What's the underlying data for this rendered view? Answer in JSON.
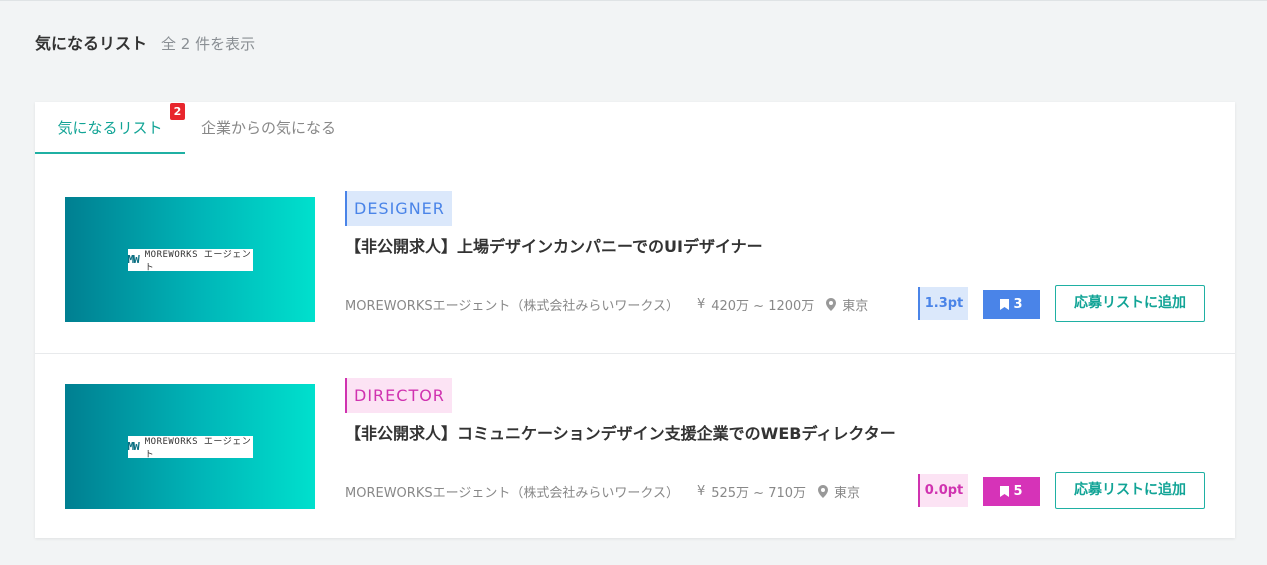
{
  "header": {
    "title": "気になるリスト",
    "count_text": "全 2 件を表示"
  },
  "tabs": [
    {
      "label": "気になるリスト",
      "badge": "2",
      "active": true
    },
    {
      "label": "企業からの気になる",
      "active": false
    }
  ],
  "jobs": [
    {
      "category": "DESIGNER",
      "title": "【非公開求人】上場デザインカンパニーでのUIデザイナー",
      "company": "MOREWORKSエージェント（株式会社みらいワークス）",
      "yen": "¥",
      "salary": "420万 ~ 1200万",
      "location": "東京",
      "points": "1.3pt",
      "bookmarks": "3",
      "apply_label": "応募リストに追加",
      "thumb_logo_mark": "MW",
      "thumb_logo_text": "MOREWORKS エージェント",
      "accent": "#4a84e8"
    },
    {
      "category": "DIRECTOR",
      "title": "【非公開求人】コミュニケーションデザイン支援企業でのWEBディレクター",
      "company": "MOREWORKSエージェント（株式会社みらいワークス）",
      "yen": "¥",
      "salary": "525万 ~ 710万",
      "location": "東京",
      "points": "0.0pt",
      "bookmarks": "5",
      "apply_label": "応募リストに追加",
      "thumb_logo_mark": "MW",
      "thumb_logo_text": "MOREWORKS エージェント",
      "accent": "#d633b8"
    }
  ],
  "icons": {
    "location": "map-pin-icon",
    "bookmark": "bookmark-icon"
  },
  "colors": {
    "teal": "#1fb0a3",
    "blue": "#4a84e8",
    "pink": "#d633b8",
    "badge_red": "#e8262d"
  }
}
